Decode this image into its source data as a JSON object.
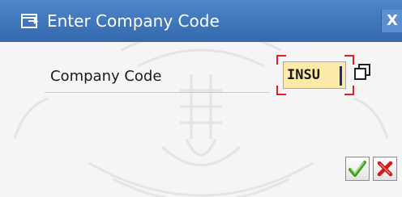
{
  "window": {
    "title": "Enter Company Code",
    "close_glyph": "X"
  },
  "form": {
    "company_code_label": "Company Code",
    "company_code_value": "INSU"
  },
  "icons": {
    "title": "dialog-window-icon",
    "value_help": "value-help-icon",
    "ok": "green-checkmark-icon",
    "cancel": "red-cross-icon"
  },
  "colors": {
    "titlebar": "#3e74b8",
    "field_bg": "#fde9a8",
    "required_corners": "#e02020",
    "ok": "#3a9a1a",
    "cancel": "#d01818"
  }
}
